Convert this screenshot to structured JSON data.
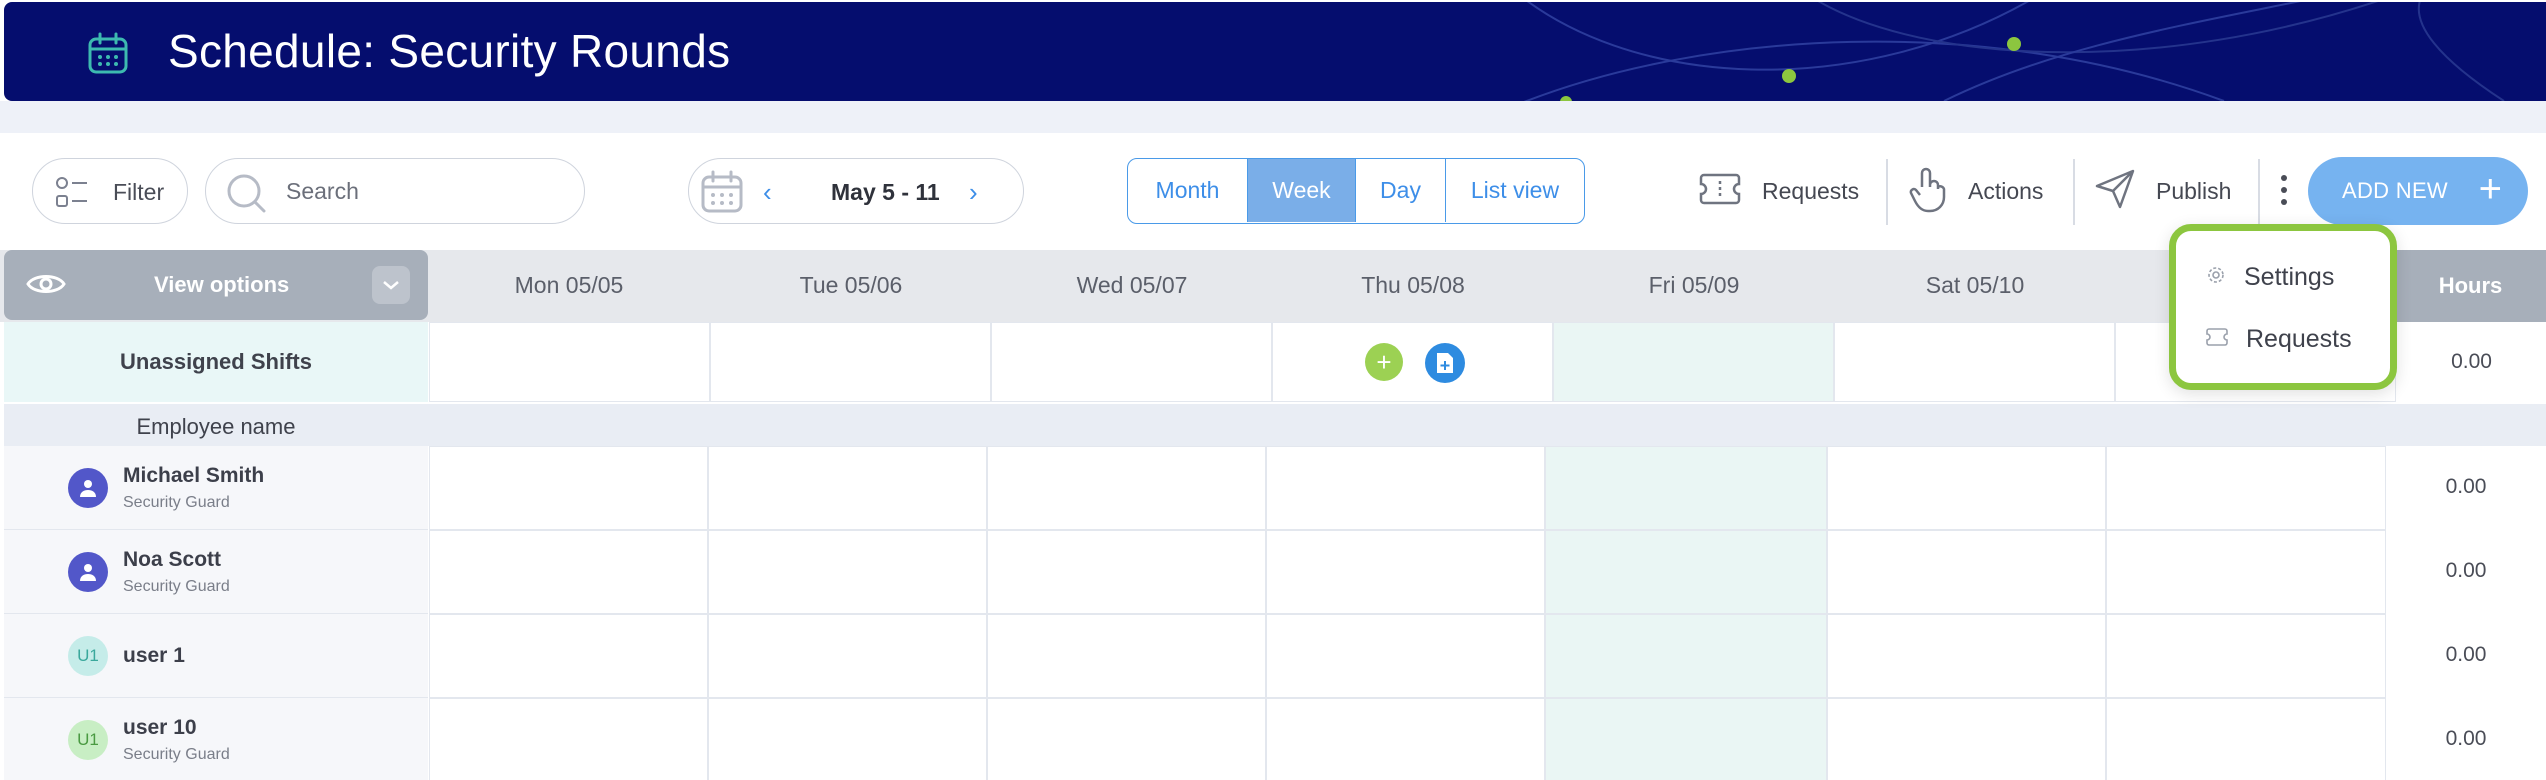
{
  "header": {
    "title": "Schedule: Security Rounds",
    "icon": "calendar-icon"
  },
  "toolbar": {
    "filter_label": "Filter",
    "search_placeholder": "Search",
    "date_range": "May 5 - 11",
    "views": [
      {
        "label": "Month",
        "active": false
      },
      {
        "label": "Week",
        "active": true
      },
      {
        "label": "Day",
        "active": false
      },
      {
        "label": "List view",
        "active": false
      }
    ],
    "requests_label": "Requests",
    "actions_label": "Actions",
    "publish_label": "Publish",
    "add_new_label": "ADD NEW"
  },
  "grid": {
    "view_options_label": "View options",
    "days": [
      "Mon 05/05",
      "Tue 05/06",
      "Wed 05/07",
      "Thu 05/08",
      "Fri 05/09",
      "Sat 05/10"
    ],
    "hours_label": "Hours",
    "unassigned_label": "Unassigned Shifts",
    "unassigned_hours": "0.00",
    "employee_header": "Employee name",
    "employees": [
      {
        "name": "Michael Smith",
        "role": "Security Guard",
        "avatar": "person-icon",
        "hours": "0.00"
      },
      {
        "name": "Noa Scott",
        "role": "Security Guard",
        "avatar": "person-icon",
        "hours": "0.00"
      },
      {
        "name": "user 1",
        "role": "",
        "avatar": "U1",
        "hours": "0.00"
      },
      {
        "name": "user 10",
        "role": "Security Guard",
        "avatar": "U1",
        "hours": "0.00"
      }
    ]
  },
  "popup_menu": {
    "items": [
      {
        "label": "Settings",
        "icon": "gear-icon"
      },
      {
        "label": "Requests",
        "icon": "requests-icon"
      }
    ]
  },
  "colors": {
    "banner": "#050d6e",
    "accent": "#3d8ee8",
    "highlight": "#8cc63f"
  }
}
